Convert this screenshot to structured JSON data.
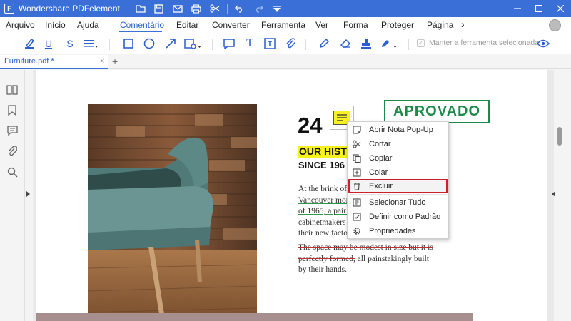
{
  "app": {
    "title": "Wondershare PDFelement"
  },
  "titlebar_icons": [
    "folder-icon",
    "save-icon",
    "mail-icon",
    "print-icon",
    "scissors-icon",
    "undo-icon",
    "redo-icon",
    "dropdown-arrow-icon"
  ],
  "menu": {
    "items": [
      "Arquivo",
      "Início",
      "Ajuda",
      "Comentário",
      "Editar",
      "Converter",
      "Ferramenta",
      "Ver",
      "Forma",
      "Proteger",
      "Página"
    ],
    "active": "Comentário",
    "more": "›"
  },
  "toolbar": {
    "keep_tool_label": "Manter a ferramenta selecionada"
  },
  "tab": {
    "name": "Furniture.pdf *",
    "close": "×",
    "add": "+"
  },
  "document": {
    "number": "24",
    "stamp": "APROVADO",
    "heading_highlight": "OUR HISTO",
    "heading_since": "SINCE 196",
    "para1_lines": [
      "At the brink of",
      "Vancouver mor",
      "of 1965, a pair c",
      "cabinetmakers",
      "their new facto"
    ],
    "para2_strike1": "The space may be modest in size but it is",
    "para2_strike2": "perfectly formed,",
    "para2_rest2": " all painstakingly built",
    "para2_line3": "by their hands."
  },
  "context_menu": {
    "items": [
      {
        "label": "Abrir Nota Pop-Up",
        "icon": "popup-note-icon"
      },
      {
        "label": "Cortar",
        "icon": "scissors-icon"
      },
      {
        "label": "Copiar",
        "icon": "copy-icon"
      },
      {
        "label": "Colar",
        "icon": "paste-icon"
      },
      {
        "label": "Excluir",
        "icon": "trash-icon"
      },
      {
        "label": "Selecionar Tudo",
        "icon": "select-all-icon"
      },
      {
        "label": "Definir como Padrão",
        "icon": "checkbox-icon"
      },
      {
        "label": "Propriedades",
        "icon": "gear-icon"
      }
    ],
    "selected": "Excluir"
  },
  "colors": {
    "accent": "#3a6fd8",
    "stamp": "#1e8a4a",
    "highlight": "#f8f21c",
    "selection_border": "#d01f2a"
  }
}
